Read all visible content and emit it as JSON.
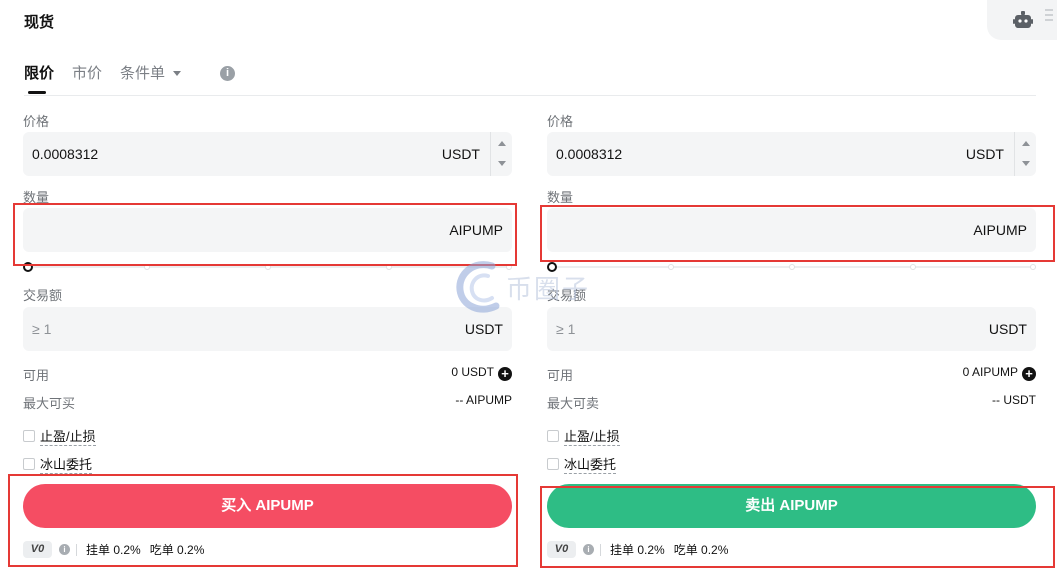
{
  "header": {
    "title": "现货"
  },
  "tabs": {
    "limit": "限价",
    "market": "市价",
    "conditional": "条件单"
  },
  "buy": {
    "price_label": "价格",
    "price_value": "0.0008312",
    "price_unit": "USDT",
    "amount_label": "数量",
    "amount_unit": "AIPUMP",
    "total_label": "交易额",
    "total_placeholder": "≥ 1",
    "total_unit": "USDT",
    "available_label": "可用",
    "available_value": "0 USDT",
    "max_label": "最大可买",
    "max_value": "-- AIPUMP",
    "tpsl_label": "止盈/止损",
    "iceberg_label": "冰山委托",
    "button_label": "买入 AIPUMP",
    "vip": "V0",
    "maker_fee": "挂单 0.2%",
    "taker_fee": "吃单 0.2%"
  },
  "sell": {
    "price_label": "价格",
    "price_value": "0.0008312",
    "price_unit": "USDT",
    "amount_label": "数量",
    "amount_unit": "AIPUMP",
    "total_label": "交易额",
    "total_placeholder": "≥ 1",
    "total_unit": "USDT",
    "available_label": "可用",
    "available_value": "0 AIPUMP",
    "max_label": "最大可卖",
    "max_value": "-- USDT",
    "tpsl_label": "止盈/止损",
    "iceberg_label": "冰山委托",
    "button_label": "卖出 AIPUMP",
    "vip": "V0",
    "maker_fee": "挂单 0.2%",
    "taker_fee": "吃单 0.2%"
  },
  "watermark": {
    "text": "币圈子"
  },
  "colors": {
    "buy": "#f54d63",
    "sell": "#2ebd85",
    "highlight": "#e53935"
  },
  "icons": [
    "robot-icon",
    "info-icon",
    "chevron-down-icon",
    "plus-circle-icon",
    "stepper-up-icon",
    "stepper-down-icon"
  ]
}
